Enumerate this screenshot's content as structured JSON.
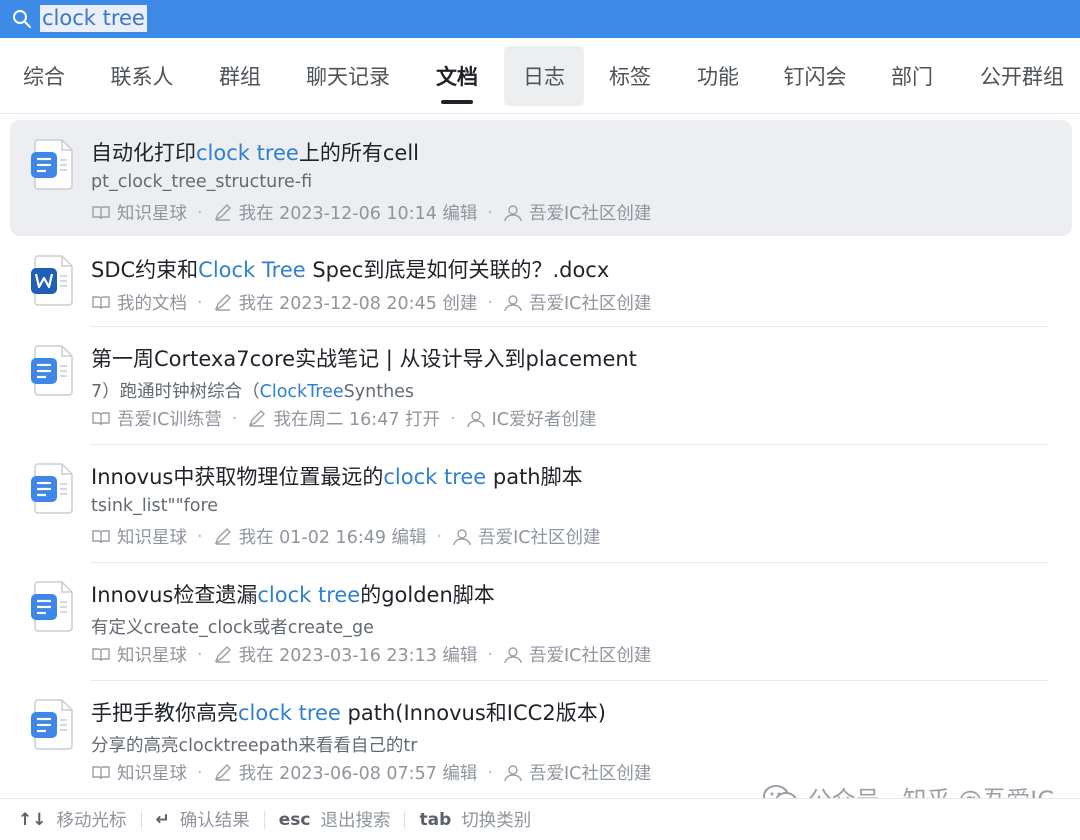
{
  "search": {
    "value": "clock tree",
    "placeholder": ""
  },
  "tabs": [
    "综合",
    "联系人",
    "群组",
    "聊天记录",
    "文档",
    "日志",
    "标签",
    "功能",
    "钉闪会",
    "部门",
    "公开群组"
  ],
  "active_tab": "文档",
  "hover_tab": "日志",
  "results": [
    {
      "icon": "doc-icon",
      "title_parts": [
        "自动化打印",
        "clock tree",
        "上的所有cell"
      ],
      "snippet_parts": [
        "pt_clock_tree_structure-fi"
      ],
      "meta": [
        "知识星球",
        "我在 2023-12-06 10:14 编辑",
        "吾爱IC社区创建"
      ],
      "selected": true
    },
    {
      "icon": "word-icon",
      "title_parts": [
        "SDC约束和",
        "Clock Tree",
        " Spec到底是如何关联的？.docx"
      ],
      "snippet_parts": [],
      "meta": [
        "我的文档",
        "我在 2023-12-08 20:45 创建",
        "吾爱IC社区创建"
      ],
      "selected": false
    },
    {
      "icon": "doc-icon",
      "title_parts": [
        "第一周Cortexa7core实战笔记 | 从设计导入到placement"
      ],
      "snippet_parts": [
        "7）跑通时钟树综合（",
        "ClockTree",
        "Synthes"
      ],
      "meta": [
        "吾爱IC训练营",
        "我在周二 16:47 打开",
        "IC爱好者创建"
      ],
      "selected": false
    },
    {
      "icon": "doc-icon",
      "title_parts": [
        "Innovus中获取物理位置最远的",
        "clock tree",
        " path脚本"
      ],
      "snippet_parts": [
        "tsink_list\"\"fore"
      ],
      "meta": [
        "知识星球",
        "我在 01-02 16:49 编辑",
        "吾爱IC社区创建"
      ],
      "selected": false
    },
    {
      "icon": "doc-icon",
      "title_parts": [
        "Innovus检查遗漏",
        "clock tree",
        "的golden脚本"
      ],
      "snippet_parts": [
        "有定义create_clock或者create_ge"
      ],
      "meta": [
        "知识星球",
        "我在 2023-03-16 23:13 编辑",
        "吾爱IC社区创建"
      ],
      "selected": false
    },
    {
      "icon": "doc-icon",
      "title_parts": [
        "手把手教你高亮",
        "clock tree",
        " path(Innovus和ICC2版本)"
      ],
      "snippet_parts": [
        "分享的高亮clocktreepath来看看自己的tr"
      ],
      "meta": [
        "知识星球",
        "我在 2023-06-08 07:57 编辑",
        "吾爱IC社区创建"
      ],
      "selected": false
    }
  ],
  "footer": {
    "hints": [
      {
        "key": "↑↓",
        "label": "移动光标"
      },
      {
        "key": "↵",
        "label": "确认结果"
      },
      {
        "key": "esc",
        "label": "退出搜索"
      },
      {
        "key": "tab",
        "label": "切换类别"
      }
    ]
  },
  "watermark": {
    "text": "公众号 · 知乎 @吾爱IC"
  },
  "colors": {
    "accent": "#3d8be6",
    "highlight": "#2f80d1",
    "selected_bg": "#eceef1"
  }
}
